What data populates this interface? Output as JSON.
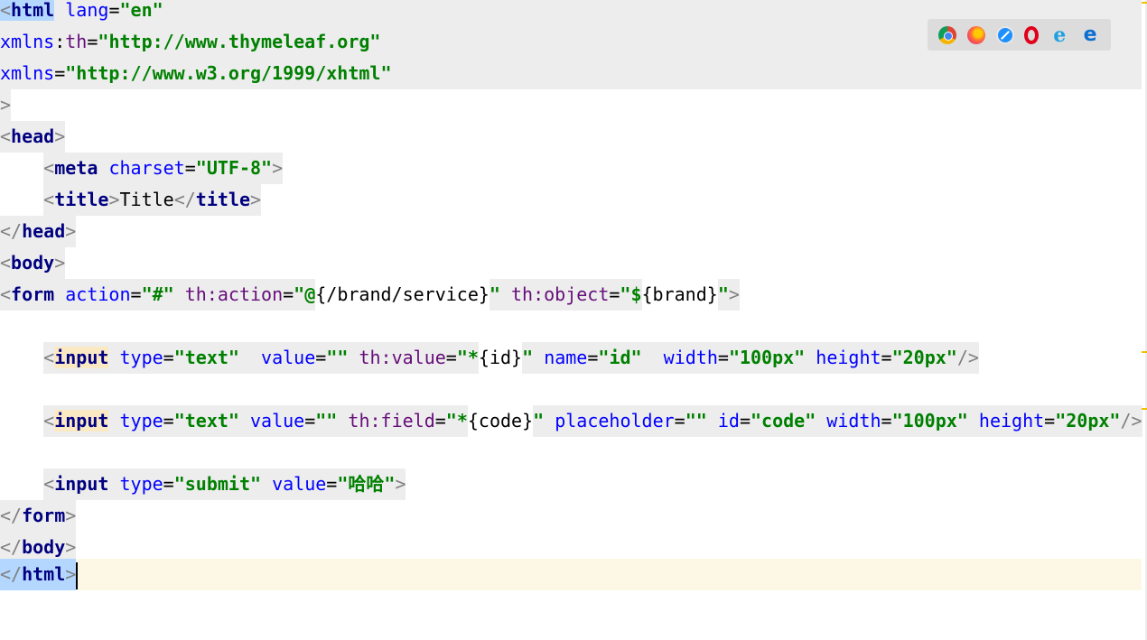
{
  "editor": {
    "lines": {
      "l1": {
        "lt": "<",
        "tag": "html",
        "sp": " ",
        "a1": "lang",
        "eq": "=",
        "v1": "\"en\""
      },
      "l2": {
        "a1": "xmlns",
        "colon": ":",
        "a1b": "th",
        "eq": "=",
        "v1": "\"http://www.thymeleaf.org\""
      },
      "l3": {
        "a1": "xmlns",
        "eq": "=",
        "v1": "\"http://www.w3.org/1999/xhtml\""
      },
      "l4": {
        "gt": ">"
      },
      "l5": {
        "lt": "<",
        "tag": "head",
        "gt": ">"
      },
      "l6": {
        "lt": "<",
        "tag": "meta",
        "sp": " ",
        "a1": "charset",
        "eq": "=",
        "v1": "\"UTF-8\"",
        "gt": ">"
      },
      "l7": {
        "lt": "<",
        "tag": "title",
        "gt": ">",
        "text": "Title",
        "lt2": "</",
        "tag2": "title",
        "gt2": ">"
      },
      "l8": {
        "lt": "</",
        "tag": "head",
        "gt": ">"
      },
      "l9": {
        "lt": "<",
        "tag": "body",
        "gt": ">"
      },
      "l10": {
        "lt": "<",
        "tag": "form",
        "a1": "action",
        "eq": "=",
        "v1": "\"#\"",
        "a2": "th:action",
        "v2a": "\"@",
        "v2b": "{/brand/service}",
        "v2c": "\"",
        "a3": "th:object",
        "v3a": "\"$",
        "v3b": "{brand}",
        "v3c": "\"",
        "gt": ">"
      },
      "l12": {
        "lt": "<",
        "tag": "input",
        "a1": "type",
        "v1": "\"text\"",
        "a2": "value",
        "v2": "\"\"",
        "a3": "th:value",
        "v3a": "\"*",
        "v3b": "{id}",
        "v3c": "\"",
        "a4": "name",
        "v4": "\"id\"",
        "a5": "width",
        "v5": "\"100px\"",
        "a6": "height",
        "v6": "\"20px\"",
        "end": "/>"
      },
      "l14": {
        "lt": "<",
        "tag": "input",
        "a1": "type",
        "v1": "\"text\"",
        "a2": "value",
        "v2": "\"\"",
        "a3": "th:field",
        "v3a": "\"*",
        "v3b": "{code}",
        "v3c": "\"",
        "a4": "placeholder",
        "v4": "\"\"",
        "a5": "id",
        "v5": "\"code\"",
        "a6": "width",
        "v6": "\"100px\"",
        "a7": "height",
        "v7": "\"20px\"",
        "end": "/>"
      },
      "l16": {
        "lt": "<",
        "tag": "input",
        "a1": "type",
        "v1": "\"submit\"",
        "a2": "value",
        "v2": "\"哈哈\"",
        "gt": ">"
      },
      "l17": {
        "lt": "</",
        "tag": "form",
        "gt": ">"
      },
      "l18": {
        "lt": "</",
        "tag": "body",
        "gt": ">"
      },
      "l19": {
        "lt": "</",
        "tag": "html",
        "gt": ">"
      }
    },
    "eq": "="
  },
  "browser_bar": {
    "icons": [
      "chrome-icon",
      "firefox-icon",
      "safari-icon",
      "opera-icon",
      "internet-explorer-icon",
      "edge-icon"
    ],
    "ie_glyph": "e",
    "edge_glyph": "e"
  },
  "colors": {
    "tag": "#000080",
    "attribute": "#0000ff",
    "thymeleaf_attribute": "#660e7a",
    "string": "#008000",
    "line_shade": "#ededed",
    "caret_line": "#fdf8e6",
    "tag_match_highlight": "#b3d7ff"
  }
}
